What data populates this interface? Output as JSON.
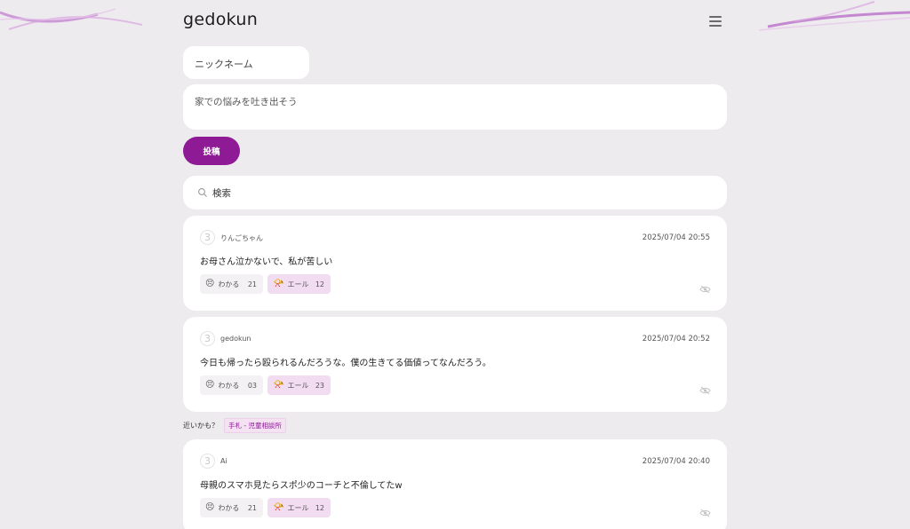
{
  "header": {
    "logo": "gedokun"
  },
  "form": {
    "nickname_placeholder": "ニックネーム",
    "body_placeholder": "家での悩みを吐き出そう",
    "post_label": "投稿"
  },
  "search": {
    "placeholder": "検索"
  },
  "posts": [
    {
      "num": "3",
      "user": "りんごちゃん",
      "time": "2025/07/04 20:55",
      "text": "お母さん泣かないで、私が苦しい",
      "wakaru_label": "わかる",
      "wakaru_count": "21",
      "yell_label": "エール",
      "yell_count": "12"
    },
    {
      "num": "3",
      "user": "gedokun",
      "time": "2025/07/04 20:52",
      "text": "今日も帰ったら殴られるんだろうな。僕の生きてる価値ってなんだろう。",
      "wakaru_label": "わかる",
      "wakaru_count": "03",
      "yell_label": "エール",
      "yell_count": "23"
    },
    {
      "num": "3",
      "user": "Ai",
      "time": "2025/07/04 20:40",
      "text": "母親のスマホ見たらスポ少のコーチと不倫してたw",
      "wakaru_label": "わかる",
      "wakaru_count": "21",
      "yell_label": "エール",
      "yell_count": "12"
    }
  ],
  "suggest": {
    "label": "近いかも？",
    "tag": "手札 - 児童相談所"
  },
  "icons": {
    "menu": "hamburger-icon",
    "search": "search-icon",
    "wakaru": "sad-face-icon",
    "yell": "horn-icon",
    "hide": "eye-off-icon"
  },
  "colors": {
    "accent": "#8e1a96",
    "background": "#eeebef",
    "yell_bg": "#f2dcf1"
  }
}
